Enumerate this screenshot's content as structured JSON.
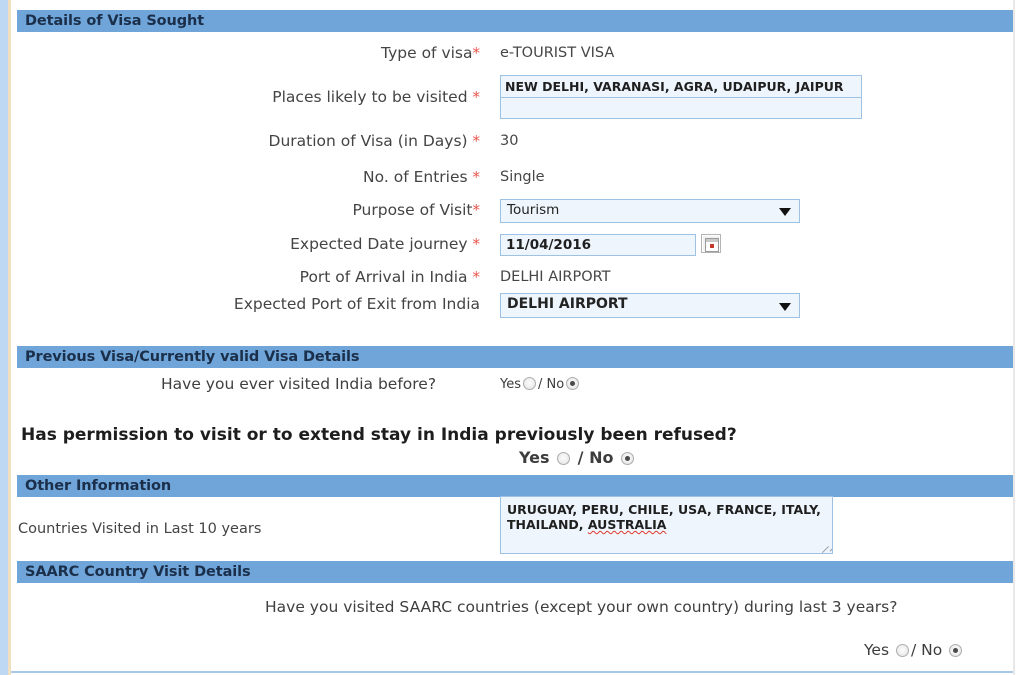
{
  "theme": {
    "section_bar_bg": "#6fa5d8",
    "section_bar_text": "#1b2f4b",
    "required_star": "#e8554b",
    "input_bg": "#eef5fc",
    "input_border": "#9dc2e3",
    "left_gutter": "#bed8f3"
  },
  "sections": {
    "visa_details": {
      "title": "Details of Visa Sought"
    },
    "previous_visa": {
      "title": "Previous Visa/Currently valid Visa Details"
    },
    "other_info": {
      "title": "Other Information"
    },
    "saarc": {
      "title": "SAARC Country Visit Details"
    }
  },
  "visa_details": {
    "type_of_visa": {
      "label": "Type of visa",
      "star": "*",
      "value": "e-TOURIST VISA"
    },
    "places_visited": {
      "label": "Places likely to be visited ",
      "star": "*",
      "value": "NEW DELHI, VARANASI, AGRA, UDAIPUR, JAIPUR"
    },
    "duration": {
      "label": "Duration of Visa (in Days) ",
      "star": "*",
      "value": "30"
    },
    "entries": {
      "label": "No. of Entries ",
      "star": "*",
      "value": "Single"
    },
    "purpose": {
      "label": "Purpose of Visit",
      "star": "*",
      "value": "Tourism",
      "options": [
        "Tourism"
      ]
    },
    "expected_date": {
      "label": "Expected Date journey ",
      "star": "*",
      "value": "11/04/2016",
      "calendar_icon": "calendar-icon"
    },
    "port_arrival": {
      "label": "Port of Arrival in India ",
      "star": "*",
      "value": "DELHI AIRPORT"
    },
    "port_exit": {
      "label": "Expected Port of Exit from India",
      "star": "",
      "value": "DELHI AIRPORT",
      "options": [
        "DELHI AIRPORT"
      ]
    }
  },
  "previous_visa": {
    "visited_before": {
      "question": "Have you ever visited India before?",
      "yes_label": "Yes",
      "separator": "/",
      "no_label": "No",
      "selected": "No"
    },
    "permission_refused": {
      "question": "Has permission to visit or to extend stay in India previously been refused?",
      "yes_label": "Yes",
      "separator": "/",
      "no_label": "No",
      "selected": "No"
    }
  },
  "other_info": {
    "countries_visited": {
      "label": "Countries Visited in Last 10 years",
      "value_line1": "URUGUAY, PERU, CHILE, USA, FRANCE, ITALY,",
      "value_line2_pre": "THAILAND, ",
      "value_line2_misspelled": "AUSTRALIA"
    }
  },
  "saarc": {
    "question": "Have you visited SAARC countries (except your own country) during last 3 years?",
    "yes_label": "Yes",
    "separator": "/",
    "no_label": "No",
    "selected": "No"
  }
}
